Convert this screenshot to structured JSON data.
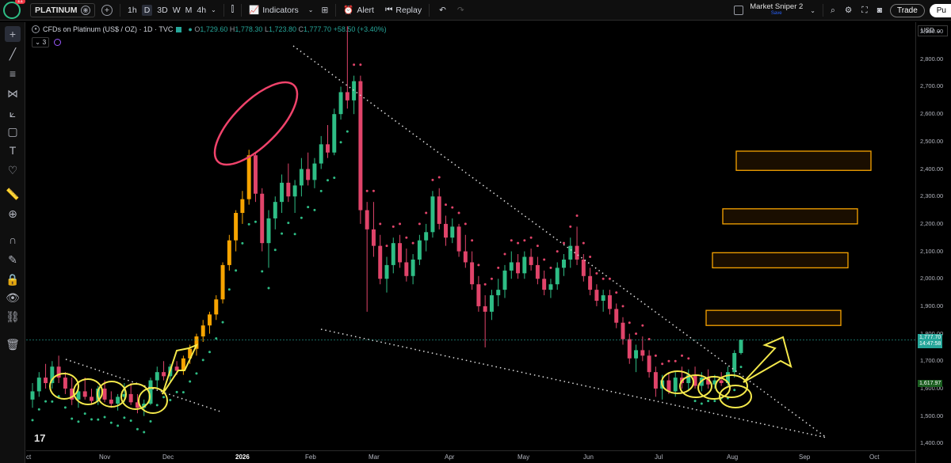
{
  "topbar": {
    "notification_count": "11",
    "symbol": "PLATINUM",
    "intervals": [
      "1h",
      "D",
      "3D",
      "W",
      "M",
      "4h"
    ],
    "selected_interval": "D",
    "indicators_label": "Indicators",
    "alert_label": "Alert",
    "replay_label": "Replay",
    "layout_name": "Market Sniper 2",
    "layout_status": "Save",
    "trade_label": "Trade",
    "publish_label": "Pu"
  },
  "legend": {
    "title": "CFDs on Platinum (US$ / OZ) · 1D · TVC",
    "open_label": "O",
    "open": "1,729.60",
    "high_label": "H",
    "high": "1,778.30",
    "low_label": "L",
    "low": "1,723.80",
    "close_label": "C",
    "close": "1,777.70",
    "change": "+58.50 (+3.40%)",
    "indicator_count": "3"
  },
  "currency": "USD",
  "colors": {
    "up": "#26a69a",
    "up_bright": "#2ebd85",
    "down": "#e0446a",
    "orange": "#f7a400",
    "yellow": "#f5e94b",
    "pink": "#f0436b",
    "bg": "#000000"
  },
  "chart_data": {
    "type": "candlestick",
    "title": "CFDs on Platinum (US$ / OZ)",
    "y_ticks": [
      "2,900.00",
      "2,800.00",
      "2,700.00",
      "2,600.00",
      "2,500.00",
      "2,400.00",
      "2,300.00",
      "2,200.00",
      "2,100.00",
      "2,000.00",
      "1,900.00",
      "1,800.00",
      "1,700.00",
      "1,600.00",
      "1,500.00",
      "1,400.00"
    ],
    "y_tick_values": [
      2900,
      2800,
      2700,
      2600,
      2500,
      2400,
      2300,
      2200,
      2100,
      2000,
      1900,
      1800,
      1700,
      1600,
      1500,
      1400
    ],
    "x_ticks": [
      "ct",
      "Nov",
      "Dec",
      "2026",
      "Feb",
      "Mar",
      "Apr",
      "May",
      "Jun",
      "Jul",
      "Aug",
      "Sep",
      "Oct"
    ],
    "ylim": [
      1375,
      2935
    ],
    "last_price_label": "1,777.70",
    "countdown_label": "14:47:58",
    "last_price": 1777.7,
    "level_label": "1,617.97",
    "level_price": 1617.97,
    "resistance_zones": [
      {
        "low": 2395,
        "high": 2465
      },
      {
        "low": 2200,
        "high": 2255
      },
      {
        "low": 2040,
        "high": 2095
      },
      {
        "low": 1830,
        "high": 1885
      }
    ],
    "candles": [
      {
        "o": 1560,
        "h": 1620,
        "l": 1530,
        "c": 1590
      },
      {
        "o": 1590,
        "h": 1660,
        "l": 1570,
        "c": 1640
      },
      {
        "o": 1640,
        "h": 1690,
        "l": 1600,
        "c": 1620
      },
      {
        "o": 1620,
        "h": 1700,
        "l": 1600,
        "c": 1680
      },
      {
        "o": 1680,
        "h": 1720,
        "l": 1620,
        "c": 1640
      },
      {
        "o": 1640,
        "h": 1660,
        "l": 1580,
        "c": 1600
      },
      {
        "o": 1600,
        "h": 1640,
        "l": 1540,
        "c": 1560
      },
      {
        "o": 1560,
        "h": 1610,
        "l": 1530,
        "c": 1590
      },
      {
        "o": 1590,
        "h": 1640,
        "l": 1560,
        "c": 1570
      },
      {
        "o": 1570,
        "h": 1600,
        "l": 1540,
        "c": 1555
      },
      {
        "o": 1555,
        "h": 1610,
        "l": 1540,
        "c": 1600
      },
      {
        "o": 1600,
        "h": 1630,
        "l": 1550,
        "c": 1560
      },
      {
        "o": 1560,
        "h": 1590,
        "l": 1530,
        "c": 1545
      },
      {
        "o": 1545,
        "h": 1580,
        "l": 1520,
        "c": 1570
      },
      {
        "o": 1570,
        "h": 1620,
        "l": 1550,
        "c": 1580
      },
      {
        "o": 1580,
        "h": 1620,
        "l": 1540,
        "c": 1550
      },
      {
        "o": 1550,
        "h": 1580,
        "l": 1510,
        "c": 1530
      },
      {
        "o": 1530,
        "h": 1560,
        "l": 1500,
        "c": 1545
      },
      {
        "o": 1545,
        "h": 1640,
        "l": 1540,
        "c": 1630
      },
      {
        "o": 1630,
        "h": 1680,
        "l": 1600,
        "c": 1660
      },
      {
        "o": 1660,
        "h": 1700,
        "l": 1630,
        "c": 1645
      },
      {
        "o": 1645,
        "h": 1690,
        "l": 1620,
        "c": 1680
      },
      {
        "o": 1680,
        "h": 1700,
        "l": 1650,
        "c": 1665
      },
      {
        "o": 1665,
        "h": 1720,
        "l": 1650,
        "c": 1710
      },
      {
        "o": 1710,
        "h": 1760,
        "l": 1690,
        "c": 1745
      },
      {
        "o": 1745,
        "h": 1800,
        "l": 1720,
        "c": 1790
      },
      {
        "o": 1790,
        "h": 1850,
        "l": 1770,
        "c": 1830
      },
      {
        "o": 1830,
        "h": 1880,
        "l": 1800,
        "c": 1870
      },
      {
        "o": 1870,
        "h": 1940,
        "l": 1850,
        "c": 1925
      },
      {
        "o": 1925,
        "h": 2060,
        "l": 1910,
        "c": 2050
      },
      {
        "o": 2050,
        "h": 2160,
        "l": 2030,
        "c": 2140
      },
      {
        "o": 2140,
        "h": 2250,
        "l": 2100,
        "c": 2240
      },
      {
        "o": 2240,
        "h": 2320,
        "l": 2200,
        "c": 2290
      },
      {
        "o": 2290,
        "h": 2470,
        "l": 2270,
        "c": 2450
      },
      {
        "o": 2450,
        "h": 2460,
        "l": 2280,
        "c": 2310
      },
      {
        "o": 2310,
        "h": 2330,
        "l": 2100,
        "c": 2130
      },
      {
        "o": 2130,
        "h": 2250,
        "l": 2040,
        "c": 2220
      },
      {
        "o": 2220,
        "h": 2300,
        "l": 2180,
        "c": 2280
      },
      {
        "o": 2280,
        "h": 2380,
        "l": 2240,
        "c": 2350
      },
      {
        "o": 2350,
        "h": 2420,
        "l": 2280,
        "c": 2300
      },
      {
        "o": 2300,
        "h": 2360,
        "l": 2240,
        "c": 2340
      },
      {
        "o": 2340,
        "h": 2440,
        "l": 2300,
        "c": 2400
      },
      {
        "o": 2400,
        "h": 2460,
        "l": 2340,
        "c": 2360
      },
      {
        "o": 2360,
        "h": 2440,
        "l": 2330,
        "c": 2420
      },
      {
        "o": 2420,
        "h": 2520,
        "l": 2400,
        "c": 2490
      },
      {
        "o": 2490,
        "h": 2560,
        "l": 2440,
        "c": 2460
      },
      {
        "o": 2460,
        "h": 2620,
        "l": 2450,
        "c": 2600
      },
      {
        "o": 2600,
        "h": 2700,
        "l": 2580,
        "c": 2680
      },
      {
        "o": 2680,
        "h": 2920,
        "l": 2620,
        "c": 2650
      },
      {
        "o": 2650,
        "h": 2740,
        "l": 2600,
        "c": 2720
      },
      {
        "o": 2720,
        "h": 2740,
        "l": 2200,
        "c": 2250
      },
      {
        "o": 2250,
        "h": 2280,
        "l": 1880,
        "c": 2180
      },
      {
        "o": 2180,
        "h": 2280,
        "l": 2080,
        "c": 2120
      },
      {
        "o": 2120,
        "h": 2160,
        "l": 1980,
        "c": 2000
      },
      {
        "o": 2000,
        "h": 2080,
        "l": 1950,
        "c": 2050
      },
      {
        "o": 2050,
        "h": 2150,
        "l": 2020,
        "c": 2130
      },
      {
        "o": 2130,
        "h": 2160,
        "l": 2040,
        "c": 2060
      },
      {
        "o": 2060,
        "h": 2110,
        "l": 1990,
        "c": 2010
      },
      {
        "o": 2010,
        "h": 2090,
        "l": 1980,
        "c": 2070
      },
      {
        "o": 2070,
        "h": 2160,
        "l": 2050,
        "c": 2140
      },
      {
        "o": 2140,
        "h": 2200,
        "l": 2100,
        "c": 2170
      },
      {
        "o": 2170,
        "h": 2320,
        "l": 2150,
        "c": 2300
      },
      {
        "o": 2300,
        "h": 2330,
        "l": 2180,
        "c": 2200
      },
      {
        "o": 2200,
        "h": 2230,
        "l": 2120,
        "c": 2150
      },
      {
        "o": 2150,
        "h": 2220,
        "l": 2130,
        "c": 2190
      },
      {
        "o": 2190,
        "h": 2200,
        "l": 2080,
        "c": 2100
      },
      {
        "o": 2100,
        "h": 2160,
        "l": 2040,
        "c": 2060
      },
      {
        "o": 2060,
        "h": 2100,
        "l": 1960,
        "c": 1980
      },
      {
        "o": 1980,
        "h": 2010,
        "l": 1880,
        "c": 1900
      },
      {
        "o": 1900,
        "h": 1940,
        "l": 1750,
        "c": 1880
      },
      {
        "o": 1880,
        "h": 1960,
        "l": 1850,
        "c": 1940
      },
      {
        "o": 1940,
        "h": 2000,
        "l": 1900,
        "c": 1960
      },
      {
        "o": 1960,
        "h": 2050,
        "l": 1930,
        "c": 2030
      },
      {
        "o": 2030,
        "h": 2100,
        "l": 2000,
        "c": 2060
      },
      {
        "o": 2060,
        "h": 2090,
        "l": 2000,
        "c": 2020
      },
      {
        "o": 2020,
        "h": 2100,
        "l": 2000,
        "c": 2080
      },
      {
        "o": 2080,
        "h": 2110,
        "l": 2030,
        "c": 2050
      },
      {
        "o": 2050,
        "h": 2080,
        "l": 1980,
        "c": 2000
      },
      {
        "o": 2000,
        "h": 2030,
        "l": 1940,
        "c": 1960
      },
      {
        "o": 1960,
        "h": 2000,
        "l": 1930,
        "c": 1980
      },
      {
        "o": 1980,
        "h": 2060,
        "l": 1960,
        "c": 2040
      },
      {
        "o": 2040,
        "h": 2090,
        "l": 2010,
        "c": 2070
      },
      {
        "o": 2070,
        "h": 2150,
        "l": 2040,
        "c": 2120
      },
      {
        "o": 2120,
        "h": 2190,
        "l": 2050,
        "c": 2070
      },
      {
        "o": 2070,
        "h": 2090,
        "l": 1990,
        "c": 2010
      },
      {
        "o": 2010,
        "h": 2040,
        "l": 1940,
        "c": 1960
      },
      {
        "o": 1960,
        "h": 1980,
        "l": 1900,
        "c": 1920
      },
      {
        "o": 1920,
        "h": 1960,
        "l": 1880,
        "c": 1940
      },
      {
        "o": 1940,
        "h": 1960,
        "l": 1870,
        "c": 1890
      },
      {
        "o": 1890,
        "h": 1910,
        "l": 1820,
        "c": 1840
      },
      {
        "o": 1840,
        "h": 1860,
        "l": 1760,
        "c": 1780
      },
      {
        "o": 1780,
        "h": 1800,
        "l": 1690,
        "c": 1710
      },
      {
        "o": 1710,
        "h": 1760,
        "l": 1660,
        "c": 1740
      },
      {
        "o": 1740,
        "h": 1790,
        "l": 1700,
        "c": 1720
      },
      {
        "o": 1720,
        "h": 1740,
        "l": 1640,
        "c": 1660
      },
      {
        "o": 1660,
        "h": 1680,
        "l": 1570,
        "c": 1600
      },
      {
        "o": 1600,
        "h": 1650,
        "l": 1560,
        "c": 1630
      },
      {
        "o": 1630,
        "h": 1660,
        "l": 1580,
        "c": 1590
      },
      {
        "o": 1590,
        "h": 1660,
        "l": 1570,
        "c": 1640
      },
      {
        "o": 1640,
        "h": 1680,
        "l": 1600,
        "c": 1620
      },
      {
        "o": 1620,
        "h": 1670,
        "l": 1590,
        "c": 1650
      },
      {
        "o": 1650,
        "h": 1680,
        "l": 1600,
        "c": 1610
      },
      {
        "o": 1610,
        "h": 1660,
        "l": 1590,
        "c": 1640
      },
      {
        "o": 1640,
        "h": 1670,
        "l": 1600,
        "c": 1615
      },
      {
        "o": 1615,
        "h": 1650,
        "l": 1600,
        "c": 1630
      },
      {
        "o": 1630,
        "h": 1660,
        "l": 1610,
        "c": 1620
      },
      {
        "o": 1620,
        "h": 1680,
        "l": 1610,
        "c": 1660
      },
      {
        "o": 1660,
        "h": 1740,
        "l": 1640,
        "c": 1729.6
      },
      {
        "o": 1729.6,
        "h": 1778.3,
        "l": 1723.8,
        "c": 1777.7
      }
    ]
  },
  "left_tools": [
    "crosshair-icon",
    "trend-line-icon",
    "fib-icon",
    "pattern-icon",
    "projection-icon",
    "rectangle-icon",
    "text-icon",
    "heart-icon",
    "ruler-icon",
    "zoom-icon",
    "magnet-icon",
    "pencil-lock-icon",
    "lock-icon",
    "eye-icon",
    "link-icon",
    "trash-icon"
  ]
}
